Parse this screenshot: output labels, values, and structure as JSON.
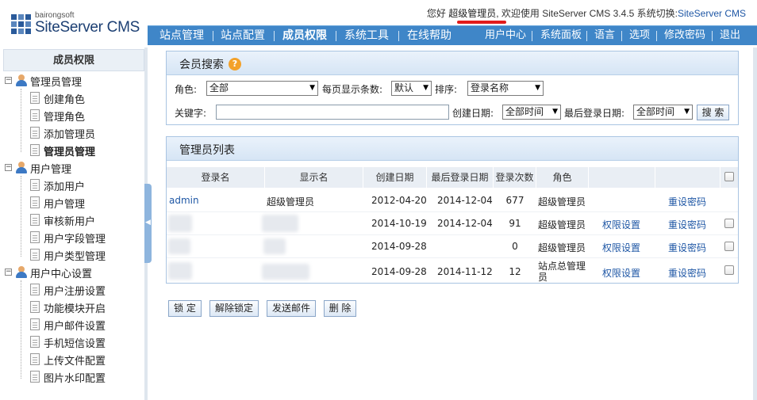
{
  "brand": {
    "small": "bairongsoft",
    "name": "SiteServer CMS"
  },
  "greeting": {
    "hello": "您好",
    "user": "超级管理员,",
    "welcome": "欢迎使用",
    "product": "SiteServer CMS 3.4.5",
    "switch_label": "系统切换:",
    "switch_target": "SiteServer CMS"
  },
  "nav": {
    "main": [
      "站点管理",
      "站点配置",
      "成员权限",
      "系统工具",
      "在线帮助"
    ],
    "active": "成员权限",
    "right": [
      "用户中心",
      "系统面板",
      "语言",
      "选项",
      "修改密码",
      "退出"
    ]
  },
  "sidebar": {
    "title": "成员权限",
    "groups": [
      {
        "label": "管理员管理",
        "items": [
          "创建角色",
          "管理角色",
          "添加管理员",
          "管理员管理"
        ]
      },
      {
        "label": "用户管理",
        "items": [
          "添加用户",
          "用户管理",
          "审核新用户",
          "用户字段管理",
          "用户类型管理"
        ]
      },
      {
        "label": "用户中心设置",
        "items": [
          "用户注册设置",
          "功能模块开启",
          "用户邮件设置",
          "手机短信设置",
          "上传文件配置",
          "图片水印配置"
        ]
      }
    ],
    "active_item": "管理员管理"
  },
  "search": {
    "title": "会员搜索",
    "role_label": "角色:",
    "role_value": "全部",
    "pagesize_label": "每页显示条数:",
    "pagesize_value": "默认",
    "order_label": "排序:",
    "order_value": "登录名称",
    "keyword_label": "关键字:",
    "keyword_value": "",
    "created_label": "创建日期:",
    "created_value": "全部时间",
    "lastlogin_label": "最后登录日期:",
    "lastlogin_value": "全部时间",
    "search_button": "搜 索"
  },
  "list": {
    "title": "管理员列表",
    "headers": [
      "登录名",
      "显示名",
      "创建日期",
      "最后登录日期",
      "登录次数",
      "角色"
    ],
    "rows": [
      {
        "login": "admin",
        "display": "超级管理员",
        "created": "2012-04-20",
        "last_login": "2014-12-04",
        "count": "677",
        "role": "超级管理员",
        "perm": "",
        "reset": "重设密码"
      },
      {
        "login": "",
        "display": "",
        "created": "2014-10-19",
        "last_login": "2014-12-04",
        "count": "91",
        "role": "超级管理员",
        "perm": "权限设置",
        "reset": "重设密码"
      },
      {
        "login": "",
        "display": "",
        "created": "2014-09-28",
        "last_login": "",
        "count": "0",
        "role": "超级管理员",
        "perm": "权限设置",
        "reset": "重设密码"
      },
      {
        "login": "",
        "display": "",
        "created": "2014-09-28",
        "last_login": "2014-11-12",
        "count": "12",
        "role": "站点总管理员",
        "perm": "权限设置",
        "reset": "重设密码"
      }
    ]
  },
  "actions": [
    "锁 定",
    "解除锁定",
    "发送邮件",
    "删 除"
  ],
  "colors": {
    "nav": "#3f86c8",
    "link": "#1f57a5",
    "panel_border": "#a9c4e2",
    "underline": "#e21b1b"
  }
}
